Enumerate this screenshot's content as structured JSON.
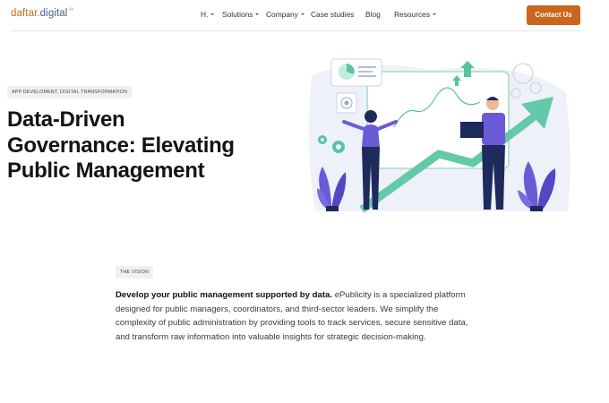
{
  "header": {
    "logo": {
      "brand": "daftar",
      "dot": ".",
      "tld": "digital",
      "superscript": "²³"
    },
    "nav": [
      {
        "label": "H.",
        "has_caret": true
      },
      {
        "label": "Solutions",
        "has_caret": true
      },
      {
        "label": "Company",
        "has_caret": true
      },
      {
        "label": "Case studies",
        "has_caret": false
      },
      {
        "label": "Blog",
        "has_caret": false
      },
      {
        "label": "Resources",
        "has_caret": true
      }
    ],
    "cta_label": "Contact Us"
  },
  "hero": {
    "tag": "APP DEVELOMENT, DIGITAL TRANSFORMATION",
    "title_lines": [
      "Data-Driven",
      "Governance: Elevating",
      "Public Management"
    ]
  },
  "vision": {
    "tag": "THE VISION",
    "lead": "Develop your public management supported by data.",
    "body": " ePublicity is a specialized platform designed for public managers, coordinators, and third-sector leaders. We simplify the complexity of public administration by providing tools to track services, secure sensitive data, and transform raw information into valuable insights for strategic decision-making."
  },
  "colors": {
    "accent": "#c9651d",
    "illustration_purple": "#6b5ad6",
    "illustration_navy": "#1d2a5c",
    "illustration_green": "#58c3a2"
  }
}
